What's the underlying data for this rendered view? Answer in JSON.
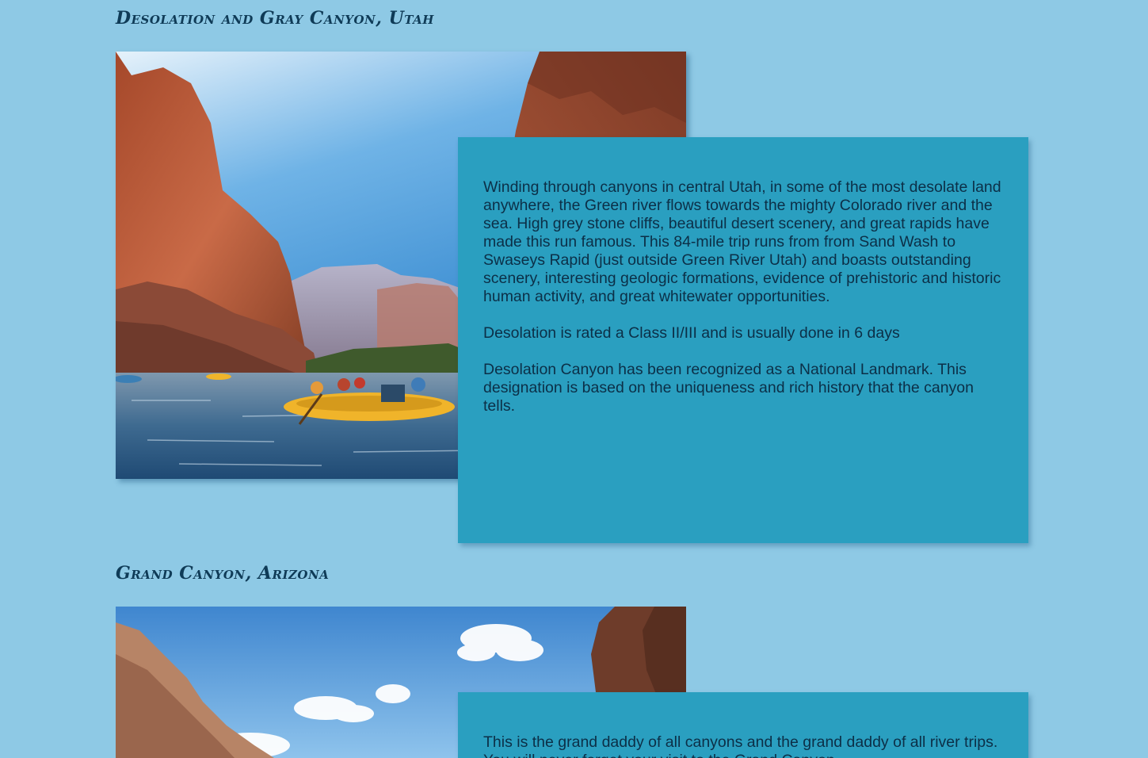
{
  "sections": [
    {
      "title": "Desolation and Gray Canyon, Utah",
      "image_subject": "rafting-canyon-photo",
      "paragraphs": [
        "Winding through canyons in central Utah, in some of the most desolate land anywhere, the Green river flows towards the mighty Colorado river and the sea. High grey stone cliffs, beautiful desert scenery, and great rapids have made this run famous. This 84-mile trip runs from from Sand Wash to Swaseys Rapid (just outside Green River Utah) and boasts outstanding scenery, interesting geologic formations, evidence of prehistoric and historic human activity, and great whitewater opportunities.",
        "Desolation is rated a Class II/III and is usually done in 6 days",
        "Desolation Canyon has been recognized as a National Landmark. This designation is based on the uniqueness and rich history that the canyon tells."
      ]
    },
    {
      "title": "Grand Canyon, Arizona",
      "image_subject": "grand-canyon-sky-photo",
      "paragraphs": [
        "This is the grand daddy of all canyons and the grand daddy of all river trips. You will never forget your visit to the Grand Canyon."
      ]
    }
  ],
  "colors": {
    "page_background": "#8ec9e5",
    "card_background": "#2a9fc0",
    "title_text": "#0f3b57",
    "body_text": "#0c2f47",
    "raft": "#f0b42a"
  }
}
